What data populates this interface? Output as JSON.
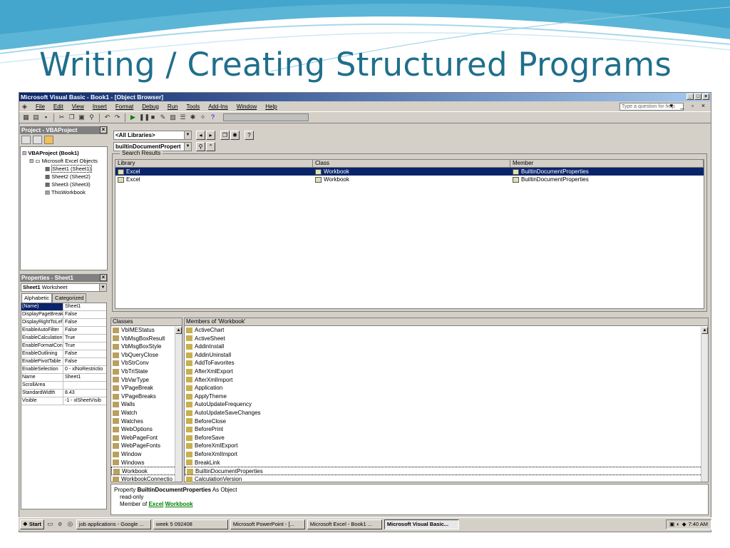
{
  "slide": {
    "title": "Writing / Creating Structured Programs"
  },
  "window": {
    "title": "Microsoft Visual Basic - Book1 - [Object Browser]"
  },
  "menu": {
    "items": [
      "File",
      "Edit",
      "View",
      "Insert",
      "Format",
      "Debug",
      "Run",
      "Tools",
      "Add-Ins",
      "Window",
      "Help"
    ],
    "ask_placeholder": "Type a question for help"
  },
  "project": {
    "title": "Project - VBAProject",
    "tree": [
      "VBAProject (Book1)",
      "Microsoft Excel Objects",
      "Sheet1 (Sheet1)",
      "Sheet2 (Sheet2)",
      "Sheet3 (Sheet3)",
      "ThisWorkbook"
    ]
  },
  "properties": {
    "title": "Properties - Sheet1",
    "object": "Sheet1",
    "object_type": "Worksheet",
    "tabs": [
      "Alphabetic",
      "Categorized"
    ],
    "rows": [
      {
        "k": "(Name)",
        "v": "Sheet1"
      },
      {
        "k": "DisplayPageBreak",
        "v": "False"
      },
      {
        "k": "DisplayRightToLef",
        "v": "False"
      },
      {
        "k": "EnableAutoFilter",
        "v": "False"
      },
      {
        "k": "EnableCalculation",
        "v": "True"
      },
      {
        "k": "EnableFormatCon",
        "v": "True"
      },
      {
        "k": "EnableOutlining",
        "v": "False"
      },
      {
        "k": "EnablePivotTable",
        "v": "False"
      },
      {
        "k": "EnableSelection",
        "v": "0 - xlNoRestrictio"
      },
      {
        "k": "Name",
        "v": "Sheet1"
      },
      {
        "k": "ScrollArea",
        "v": ""
      },
      {
        "k": "StandardWidth",
        "v": "8.43"
      },
      {
        "k": "Visible",
        "v": "-1 - xlSheetVisib"
      }
    ]
  },
  "browser": {
    "library": "<All Libraries>",
    "search": "builtinDocumentPropert",
    "search_results_label": "Search Results",
    "columns": [
      "Library",
      "Class",
      "Member"
    ],
    "results": [
      {
        "library": "Excel",
        "class": "Workbook",
        "member": "BuiltinDocumentProperties"
      },
      {
        "library": "Excel",
        "class": "Workbook",
        "member": "BuiltinDocumentProperties"
      }
    ],
    "classes_header": "Classes",
    "classes": [
      "VbIMEStatus",
      "VbMsgBoxResult",
      "VbMsgBoxStyle",
      "VbQueryClose",
      "VbStrConv",
      "VbTriState",
      "VbVarType",
      "VPageBreak",
      "VPageBreaks",
      "Walls",
      "Watch",
      "Watches",
      "WebOptions",
      "WebPageFont",
      "WebPageFonts",
      "Window",
      "Windows",
      "Workbook",
      "WorkbookConnectio"
    ],
    "members_header": "Members of 'Workbook'",
    "members": [
      "ActiveChart",
      "ActiveSheet",
      "AddinInstall",
      "AddinUninstall",
      "AddToFavorites",
      "AfterXmlExport",
      "AfterXmlImport",
      "Application",
      "ApplyTheme",
      "AutoUpdateFrequency",
      "AutoUpdateSaveChanges",
      "BeforeClose",
      "BeforePrint",
      "BeforeSave",
      "BeforeXmlExport",
      "BeforeXmlImport",
      "BreakLink",
      "BuiltinDocumentProperties",
      "CalculationVersion"
    ],
    "details": {
      "prefix": "Property",
      "name": "BuiltinDocumentProperties",
      "suffix": "As Object",
      "line2": "read-only",
      "member_of": "Member of",
      "lib": "Excel",
      "cls": "Workbook"
    }
  },
  "taskbar": {
    "start": "Start",
    "tasks": [
      "job applications - Google ...",
      "week 5 092408",
      "Microsoft PowerPoint - [...",
      "Microsoft Excel - Book1 ...",
      "Microsoft Visual Basic..."
    ],
    "time": "7:40 AM"
  }
}
